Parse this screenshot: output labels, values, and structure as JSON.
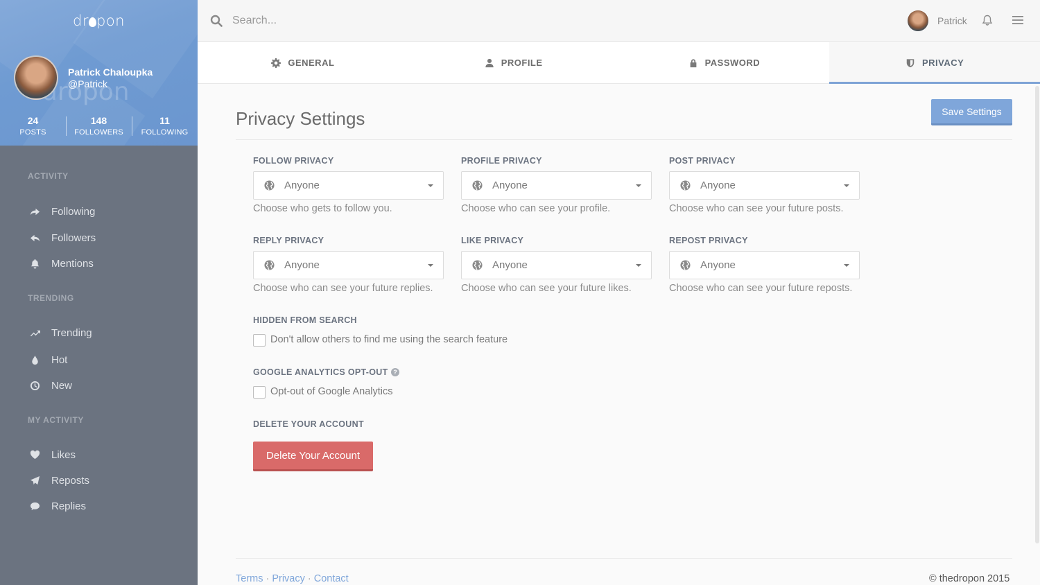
{
  "brand": {
    "name_prefix": "dr",
    "name_suffix": "pon",
    "watermark": "dropon"
  },
  "user": {
    "full_name": "Patrick Chaloupka",
    "handle": "@Patrick",
    "short_name": "Patrick"
  },
  "stats": [
    {
      "value": "24",
      "label": "POSTS"
    },
    {
      "value": "148",
      "label": "FOLLOWERS"
    },
    {
      "value": "11",
      "label": "FOLLOWING"
    }
  ],
  "sidebar": {
    "sections": [
      "ACTIVITY",
      "TRENDING",
      "MY ACTIVITY"
    ],
    "activity": [
      "Following",
      "Followers",
      "Mentions"
    ],
    "trending": [
      "Trending",
      "Hot",
      "New"
    ],
    "my_activity": [
      "Likes",
      "Reposts",
      "Replies"
    ]
  },
  "search": {
    "placeholder": "Search..."
  },
  "tabs": [
    {
      "label": "GENERAL",
      "icon": "gear-icon"
    },
    {
      "label": "PROFILE",
      "icon": "user-icon"
    },
    {
      "label": "PASSWORD",
      "icon": "lock-icon"
    },
    {
      "label": "PRIVACY",
      "icon": "shield-icon",
      "active": true
    }
  ],
  "page": {
    "title": "Privacy Settings",
    "save_label": "Save Settings"
  },
  "privacy_fields": [
    {
      "label": "FOLLOW PRIVACY",
      "value": "Anyone",
      "help": "Choose who gets to follow you."
    },
    {
      "label": "PROFILE PRIVACY",
      "value": "Anyone",
      "help": "Choose who can see your profile."
    },
    {
      "label": "POST PRIVACY",
      "value": "Anyone",
      "help": "Choose who can see your future posts."
    },
    {
      "label": "REPLY PRIVACY",
      "value": "Anyone",
      "help": "Choose who can see your future replies."
    },
    {
      "label": "LIKE PRIVACY",
      "value": "Anyone",
      "help": "Choose who can see your future likes."
    },
    {
      "label": "REPOST PRIVACY",
      "value": "Anyone",
      "help": "Choose who can see your future reposts."
    }
  ],
  "hidden_search": {
    "label": "HIDDEN FROM SEARCH",
    "checkbox": "Don't allow others to find me using the search feature"
  },
  "analytics": {
    "label": "GOOGLE ANALYTICS OPT-OUT",
    "help_glyph": "?",
    "checkbox": "Opt-out of Google Analytics"
  },
  "delete": {
    "label": "DELETE YOUR ACCOUNT",
    "button": "Delete Your Account"
  },
  "footer": {
    "links": [
      "Terms",
      "Privacy",
      "Contact"
    ],
    "separator": "·",
    "copyright": "© thedropon 2015"
  },
  "colors": {
    "accent": "#7fa6da",
    "danger": "#d96a69",
    "sidebar": "#6b7380"
  }
}
